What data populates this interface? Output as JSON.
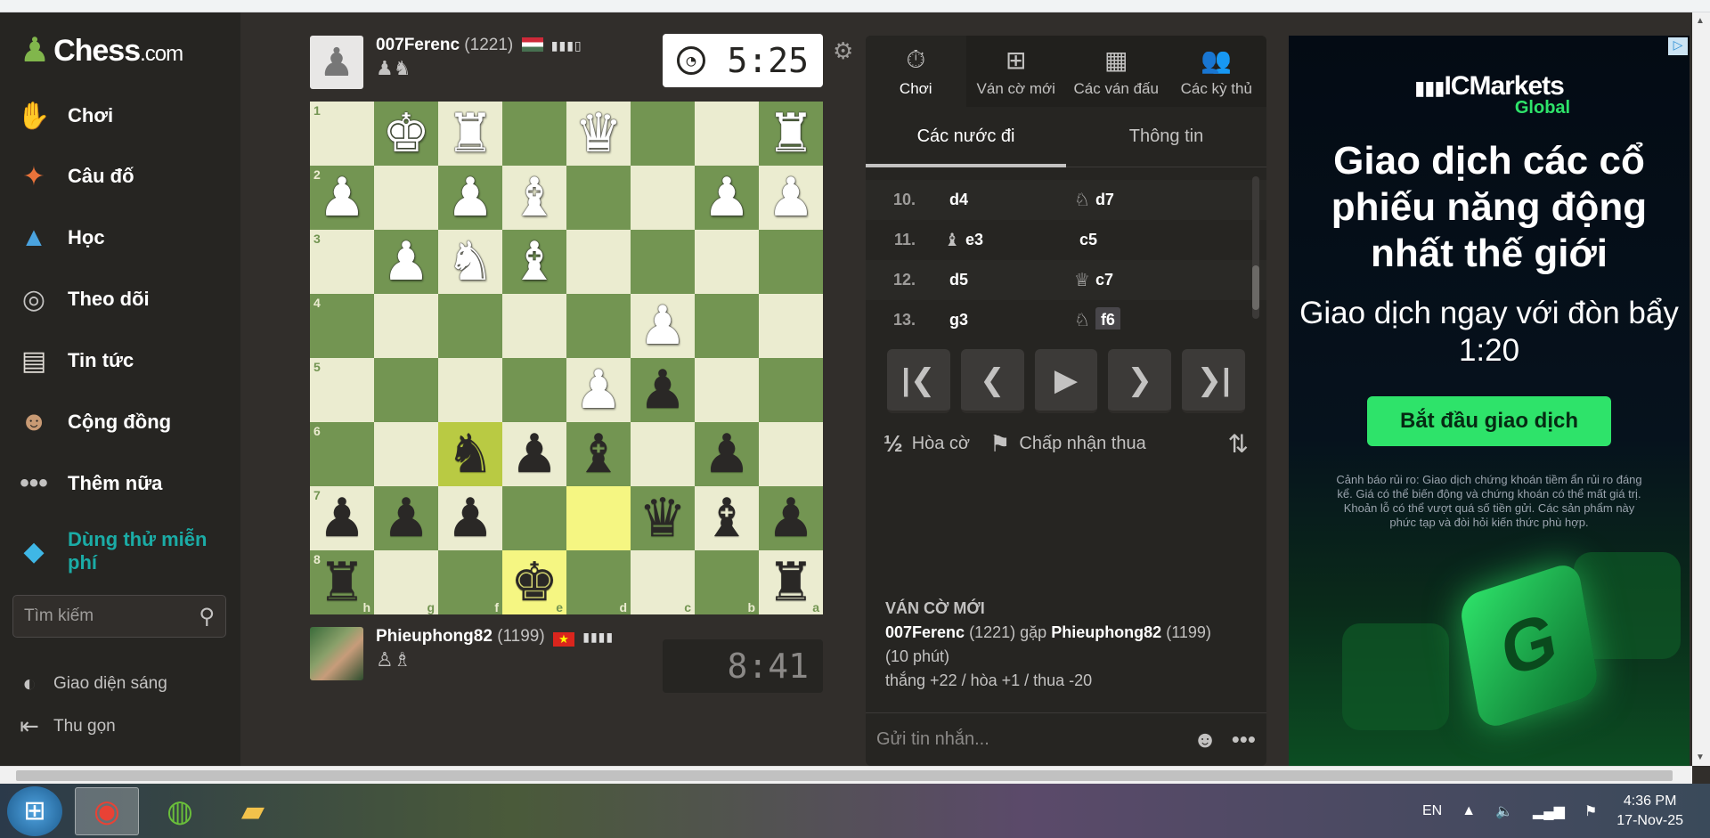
{
  "sidebar": {
    "logo_text": "Chess",
    "logo_suffix": ".com",
    "items": [
      {
        "label": "Chơi",
        "icon": "play-hand-icon"
      },
      {
        "label": "Câu đố",
        "icon": "puzzle-icon"
      },
      {
        "label": "Học",
        "icon": "graduation-cap-icon"
      },
      {
        "label": "Theo dõi",
        "icon": "binoculars-icon"
      },
      {
        "label": "Tin tức",
        "icon": "newspaper-icon"
      },
      {
        "label": "Cộng đồng",
        "icon": "community-icon"
      },
      {
        "label": "Thêm nữa",
        "icon": "more-dots-icon"
      }
    ],
    "try_free": "Dùng thử miễn phí",
    "search_placeholder": "Tìm kiếm",
    "light_mode": "Giao diện sáng",
    "collapse": "Thu gọn"
  },
  "top_player": {
    "name": "007Ferenc",
    "rating": "(1221)",
    "flag": "Hungary",
    "clock": "5:25"
  },
  "bottom_player": {
    "name": "Phieuphong82",
    "rating": "(1199)",
    "flag": "Vietnam",
    "clock": "8:41"
  },
  "board": {
    "ranks": [
      "1",
      "2",
      "3",
      "4",
      "5",
      "6",
      "7",
      "8"
    ],
    "files": [
      "h",
      "g",
      "f",
      "e",
      "d",
      "c",
      "b",
      "a"
    ],
    "rows": [
      [
        "",
        "wK",
        "wR",
        "",
        "wQ",
        "",
        "",
        "wR"
      ],
      [
        "wP",
        "",
        "wP",
        "wB",
        "",
        "",
        "wP",
        "wP"
      ],
      [
        "",
        "wP",
        "wN",
        "wB",
        "",
        "",
        "",
        ""
      ],
      [
        "",
        "",
        "",
        "",
        "",
        "wP",
        "",
        ""
      ],
      [
        "",
        "",
        "",
        "",
        "wP",
        "bP",
        "",
        ""
      ],
      [
        "",
        "",
        "bN",
        "bP",
        "bB",
        "",
        "bP",
        ""
      ],
      [
        "bP",
        "bP",
        "bP",
        "",
        "",
        "bQ",
        "bB",
        "bP"
      ],
      [
        "bR",
        "",
        "",
        "bK",
        "",
        "",
        "",
        "bR"
      ]
    ],
    "highlights": [
      "5-2",
      "6-4",
      "7-3"
    ]
  },
  "panel": {
    "tabs": [
      {
        "label": "Chơi",
        "icon": "stopwatch-icon"
      },
      {
        "label": "Ván cờ mới",
        "icon": "plus-square-icon"
      },
      {
        "label": "Các ván đấu",
        "icon": "checkerboard-icon"
      },
      {
        "label": "Các kỳ thủ",
        "icon": "players-icon"
      }
    ],
    "subtabs": [
      "Các nước đi",
      "Thông tin"
    ],
    "moves": [
      {
        "num": "10.",
        "white": "d4",
        "wpiece": "",
        "black": "d7",
        "bpiece": "♘"
      },
      {
        "num": "11.",
        "white": "e3",
        "wpiece": "♝",
        "black": "c5",
        "bpiece": ""
      },
      {
        "num": "12.",
        "white": "d5",
        "wpiece": "",
        "black": "c7",
        "bpiece": "♕"
      },
      {
        "num": "13.",
        "white": "g3",
        "wpiece": "",
        "black": "f6",
        "bpiece": "♘"
      }
    ],
    "draw_label": "Hòa cờ",
    "resign_label": "Chấp nhận thua",
    "info_heading": "VÁN CỜ MỚI",
    "info_p1": "007Ferenc",
    "info_p1_rating": "(1221)",
    "info_vs": "gặp",
    "info_p2": "Phieuphong82",
    "info_p2_rating": "(1199)",
    "info_time": "(10 phút)",
    "info_stakes": "thắng +22 / hòa +1 / thua -20",
    "chat_placeholder": "Gửi tin nhắn..."
  },
  "ad": {
    "brand": "ICMarkets",
    "brand_sub": "Global",
    "headline": "Giao dịch các cổ phiếu năng động nhất thế giới",
    "subline": "Giao dịch ngay với đòn bẩy 1:20",
    "cta": "Bắt đầu giao dịch",
    "warning": "Cảnh báo rủi ro: Giao dịch chứng khoán tiềm ẩn rủi ro đáng kể. Giá có thể biến động và chứng khoán có thể mất giá trị. Khoản lỗ có thể vượt quá số tiền gửi. Các sản phẩm này phức tạp và đòi hỏi kiến thức phù hợp."
  },
  "taskbar": {
    "lang": "EN",
    "time": "4:36 PM",
    "date": "17-Nov-25"
  }
}
